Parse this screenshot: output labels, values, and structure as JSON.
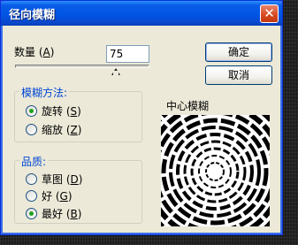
{
  "dialog": {
    "title": "径向模糊",
    "amount_label": "数量",
    "amount_hotkey": "A",
    "amount_value": "75",
    "amount_slider_max": 100,
    "ok_label": "确定",
    "cancel_label": "取消",
    "blur_method": {
      "title": "模糊方法:",
      "options": [
        {
          "label": "旋转",
          "hotkey": "S",
          "checked": true
        },
        {
          "label": "缩放",
          "hotkey": "Z",
          "checked": false
        }
      ]
    },
    "quality": {
      "title": "品质:",
      "options": [
        {
          "label": "草图",
          "hotkey": "D",
          "checked": false
        },
        {
          "label": "好",
          "hotkey": "G",
          "checked": false
        },
        {
          "label": "最好",
          "hotkey": "B",
          "checked": true
        }
      ]
    },
    "center_label": "中心模糊"
  }
}
